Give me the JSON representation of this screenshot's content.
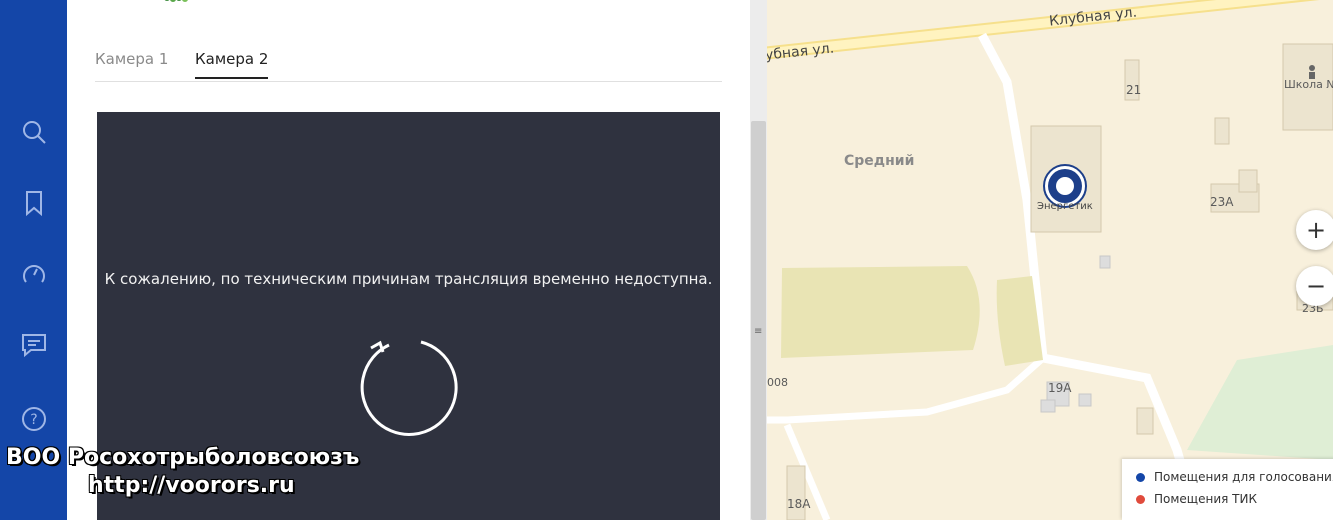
{
  "sidebar": {
    "items": [
      {
        "icon": "search-icon"
      },
      {
        "icon": "bookmark-icon"
      },
      {
        "icon": "speedometer-icon"
      },
      {
        "icon": "chat-icon"
      },
      {
        "icon": "help-icon",
        "label": "?"
      }
    ],
    "color": "#1446a8"
  },
  "tabs": [
    {
      "label": "Камера 1",
      "active": false
    },
    {
      "label": "Камера 2",
      "active": true
    }
  ],
  "video": {
    "message": "К сожалению, по техническим причинам трансляция временно недоступна.",
    "reload_icon": "reload-icon"
  },
  "map": {
    "labels": {
      "street_top_right": "Клубная ул.",
      "street_top_left": "убная ул.",
      "district": "Средний",
      "school": "Школа №",
      "poi": "Энергетик",
      "b21": "21",
      "b23a": "23А",
      "b23b": "23Б",
      "b19a": "19А",
      "b18a": "18А",
      "b008": "008"
    },
    "zoom_in": "+",
    "zoom_out": "−",
    "legend": [
      {
        "label": "Помещения для голосования",
        "color": "#1446a8"
      },
      {
        "label": "Помещения ТИК",
        "color": "#e04b3c"
      }
    ]
  },
  "watermark": {
    "line1": "ВОО Росохотрыболовсоюзъ",
    "line2": "http://voorors.ru"
  }
}
